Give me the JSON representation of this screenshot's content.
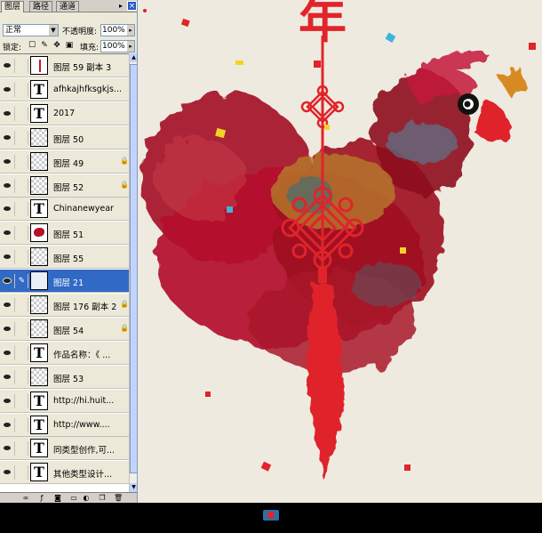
{
  "panel": {
    "tabs": [
      "图层",
      "路径",
      "通道"
    ],
    "close_glyph": "×",
    "menu_glyph": "▸",
    "blend_mode": "正常",
    "opacity_label": "不透明度:",
    "opacity_value": "100%",
    "lock_label": "锁定:",
    "fill_label": "填充:",
    "fill_value": "100%"
  },
  "layers": [
    {
      "name": "图层 59 副本 3",
      "thumb": "sketch",
      "locked": false,
      "selected": false
    },
    {
      "name": "afhkajhfksgkjs...",
      "thumb": "text",
      "locked": false,
      "selected": false
    },
    {
      "name": "2017",
      "thumb": "text",
      "locked": false,
      "selected": false
    },
    {
      "name": "图层 50",
      "thumb": "checker",
      "locked": false,
      "selected": false
    },
    {
      "name": "图层 49",
      "thumb": "checker",
      "locked": true,
      "selected": false
    },
    {
      "name": "图层 52",
      "thumb": "checker",
      "locked": true,
      "selected": false
    },
    {
      "name": "Chinanewyear",
      "thumb": "text",
      "locked": false,
      "selected": false
    },
    {
      "name": "图层 51",
      "thumb": "blob",
      "locked": false,
      "selected": false
    },
    {
      "name": "图层 55",
      "thumb": "checker",
      "locked": false,
      "selected": false
    },
    {
      "name": "图层 21",
      "thumb": "pale",
      "locked": false,
      "selected": true
    },
    {
      "name": "图层 176 副本 2",
      "thumb": "checker",
      "locked": true,
      "selected": false
    },
    {
      "name": "图层 54",
      "thumb": "checker",
      "locked": true,
      "selected": false
    },
    {
      "name": "作品名称：《 ...",
      "thumb": "text",
      "locked": false,
      "selected": false
    },
    {
      "name": "图层 53",
      "thumb": "checker",
      "locked": false,
      "selected": false
    },
    {
      "name": "http://hi.huit...",
      "thumb": "text",
      "locked": false,
      "selected": false
    },
    {
      "name": "http://www....",
      "thumb": "text",
      "locked": false,
      "selected": false
    },
    {
      "name": "同类型创作,可...",
      "thumb": "text",
      "locked": false,
      "selected": false
    },
    {
      "name": "其他类型设计...",
      "thumb": "text",
      "locked": false,
      "selected": false
    }
  ],
  "canvas": {
    "title_glyph": "年"
  },
  "colors": {
    "panel_bg": "#ece9d8",
    "selected": "#316ac5",
    "canvas_bg": "#efeae0",
    "rooster_red": "#b4102a",
    "knot_red": "#e0242a"
  }
}
